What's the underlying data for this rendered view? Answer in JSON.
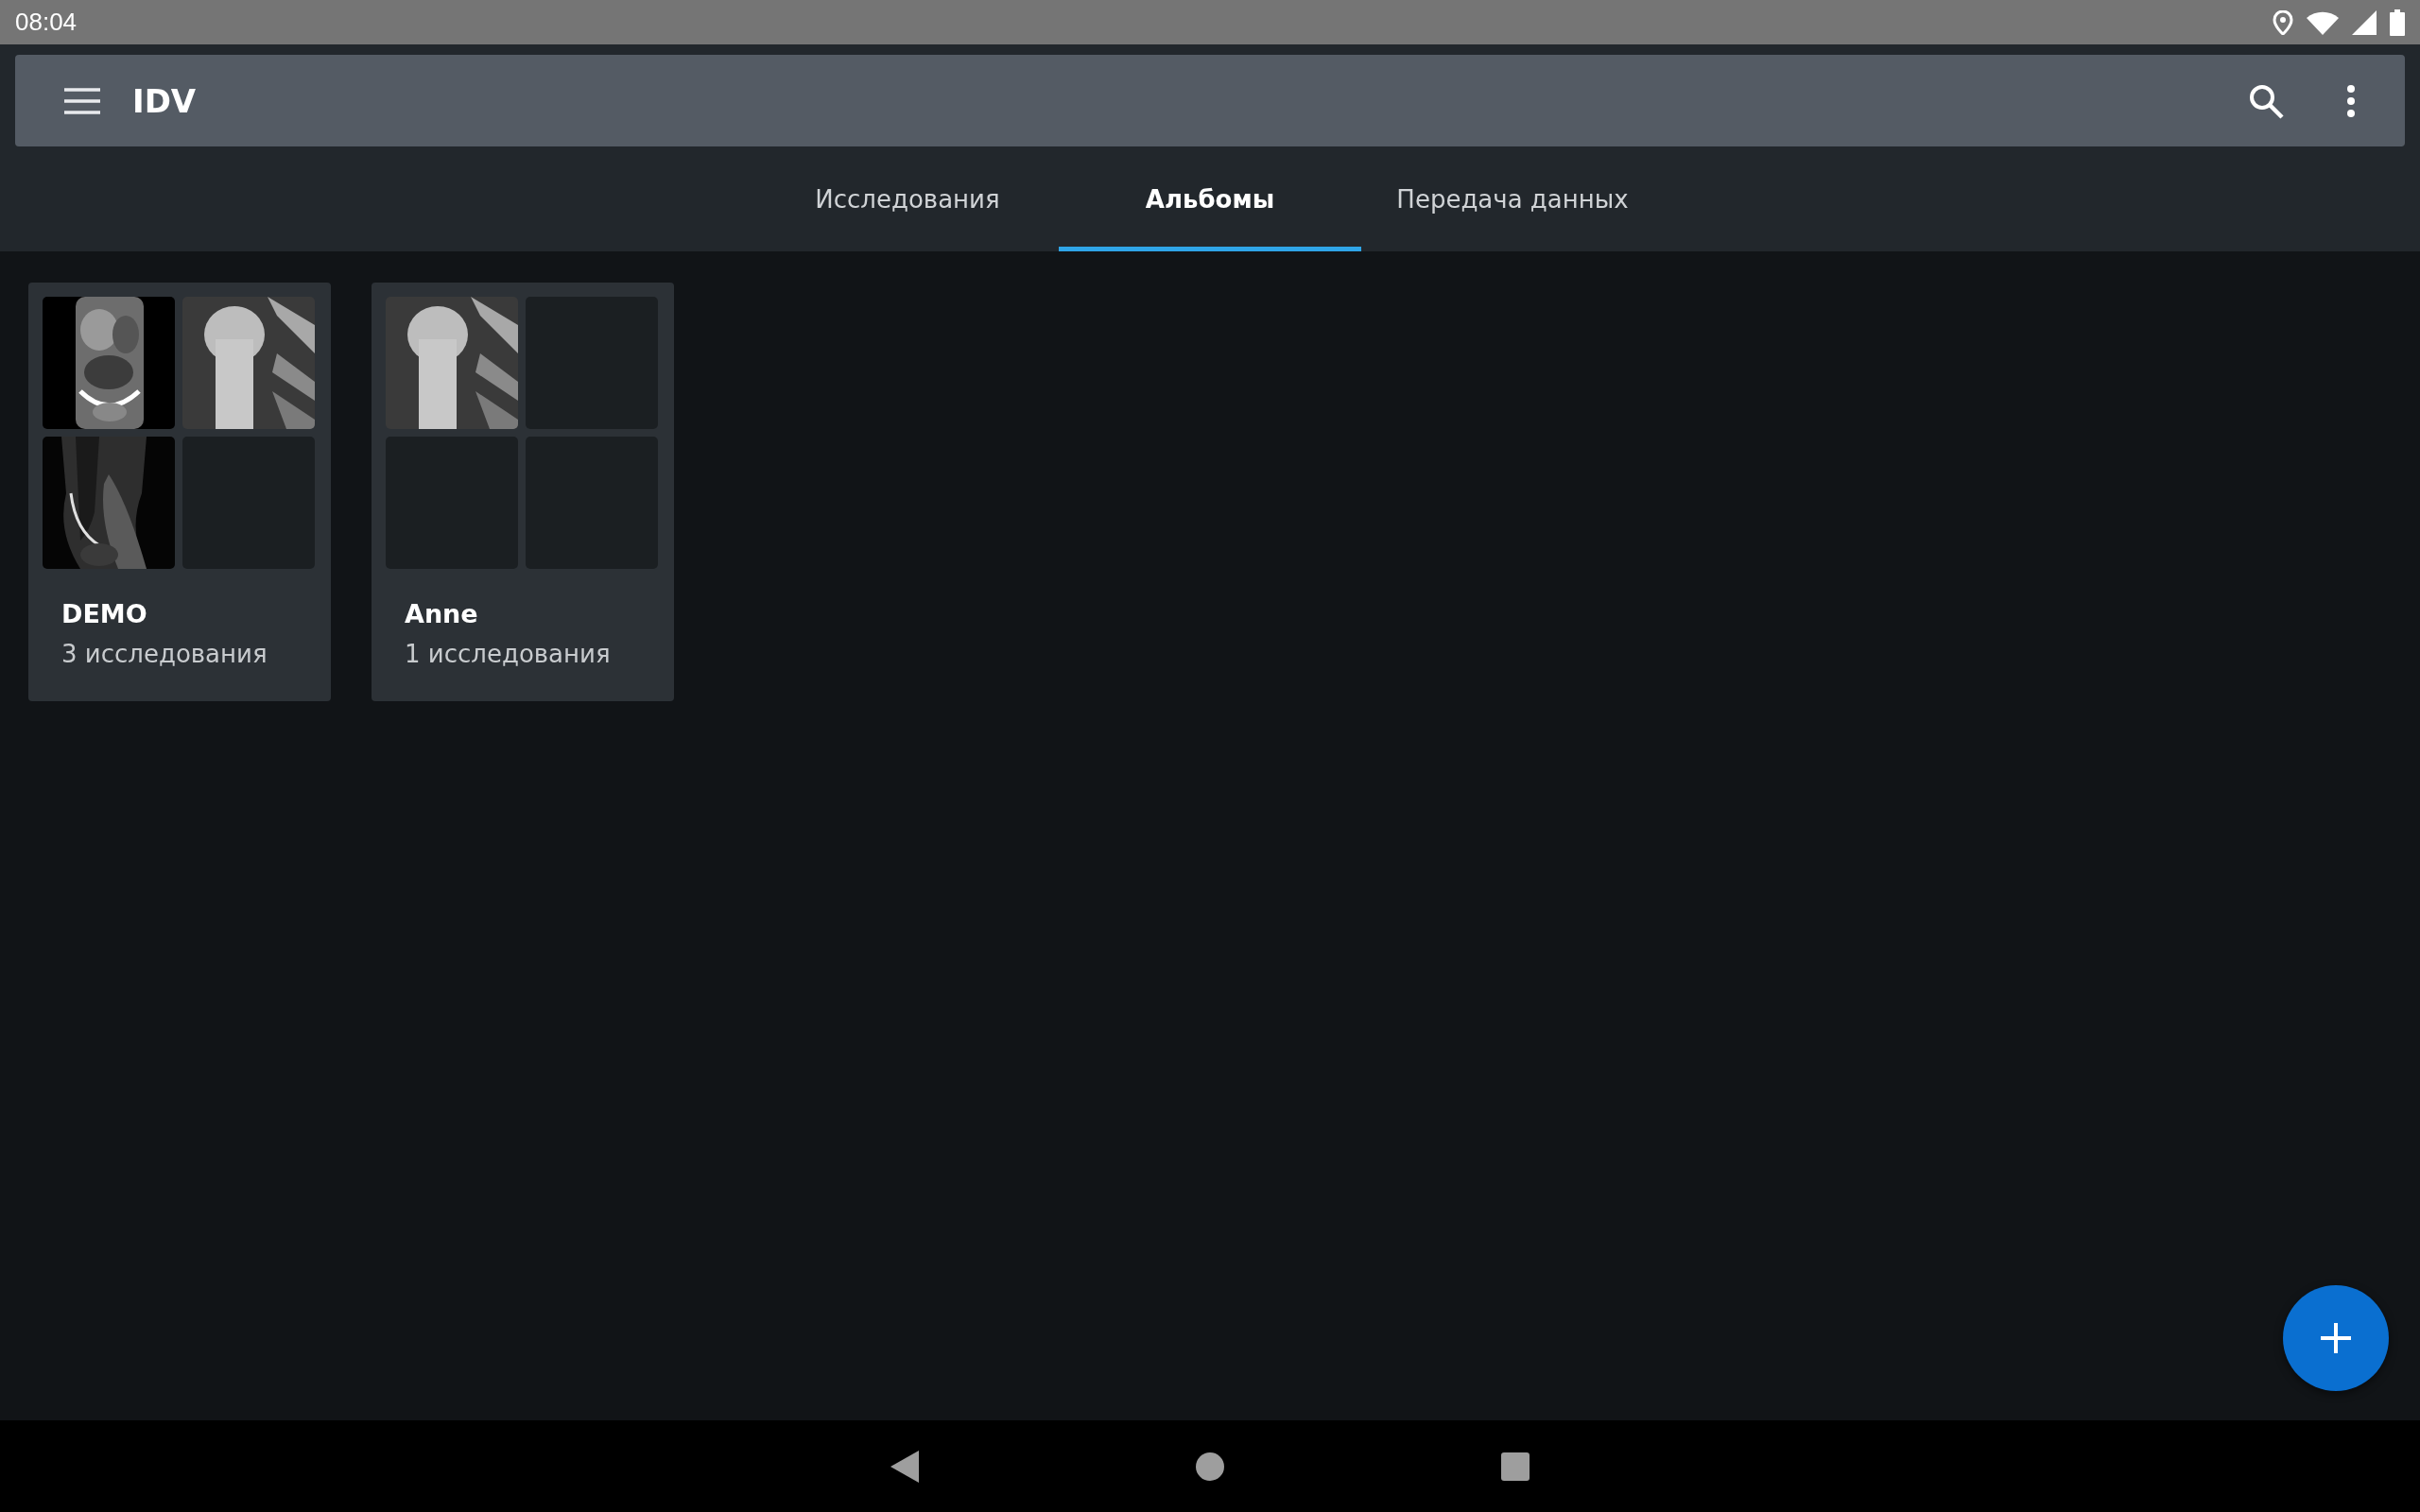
{
  "status_bar": {
    "time": "08:04"
  },
  "toolbar": {
    "title": "IDV"
  },
  "tabs": [
    {
      "label": "Исследования",
      "selected": false
    },
    {
      "label": "Альбомы",
      "selected": true
    },
    {
      "label": "Передача данных",
      "selected": false
    }
  ],
  "albums": [
    {
      "title": "DEMO",
      "count": "3 исследования",
      "thumbnails": [
        {
          "kind": "picture"
        },
        {
          "kind": "picture"
        },
        {
          "kind": "picture"
        },
        {
          "kind": "empty"
        }
      ]
    },
    {
      "title": "Anne",
      "count": "1 исследования",
      "thumbnails": [
        {
          "kind": "picture"
        },
        {
          "kind": "empty"
        },
        {
          "kind": "empty"
        },
        {
          "kind": "empty"
        }
      ]
    }
  ]
}
